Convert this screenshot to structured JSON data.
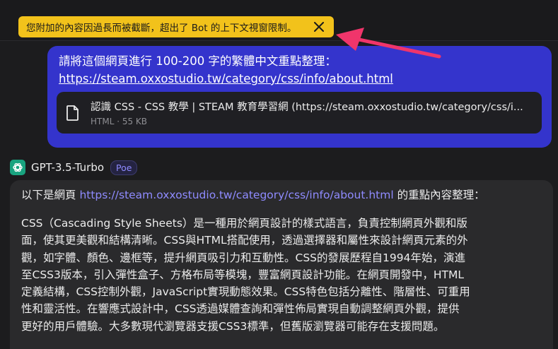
{
  "toast": {
    "message": "您附加的內容因過長而被截斷，超出了 Bot 的上下文視窗限制。",
    "close_icon": "×",
    "background": "#f2c21b"
  },
  "annotation_arrow": {
    "color": "#f0356b"
  },
  "user_message": {
    "line1": "請將這個網頁進行 100-200 字的繁體中文重點整理：",
    "link": "https://steam.oxxostudio.tw/category/css/info/about.html",
    "bubble_color": "#3434cc",
    "attachment": {
      "icon": "file-icon",
      "title": "認識 CSS - CSS 教學 | STEAM 教育學習網 (https://steam.oxxostudio.tw/category/css/i...",
      "meta": "HTML · 55 KB"
    }
  },
  "bot": {
    "name": "GPT-3.5-Turbo",
    "badge": "Poe",
    "avatar_icon": "openai-logo-icon",
    "avatar_color": "#19a37f",
    "intro_prefix": "以下是網頁 ",
    "intro_link": "https://steam.oxxostudio.tw/category/css/info/about.html",
    "intro_suffix": " 的重點內容整理：",
    "paragraph_lines": [
      "CSS（Cascading Style Sheets）是一種用於網頁設計的樣式語言，負責控制網頁外觀和版",
      "面，使其更美觀和結構清晰。CSS與HTML搭配使用，透過選擇器和屬性來設計網頁元素的外",
      "觀，如字體、顏色、邊框等，提升網頁吸引力和互動性。CSS的發展歷程自1994年始，演進",
      "至CSS3版本，引入彈性盒子、方格布局等模塊，豐富網頁設計功能。在網頁開發中，HTML",
      "定義結構，CSS控制外觀，JavaScript實現動態效果。CSS特色包括分離性、階層性、可重用",
      "性和靈活性。在響應式設計中，CSS透過媒體查詢和彈性佈局實現自動調整網頁外觀，提供",
      "更好的用戶體驗。大多數現代瀏覽器支援CSS3標準，但舊版瀏覽器可能存在支援問題。"
    ]
  }
}
